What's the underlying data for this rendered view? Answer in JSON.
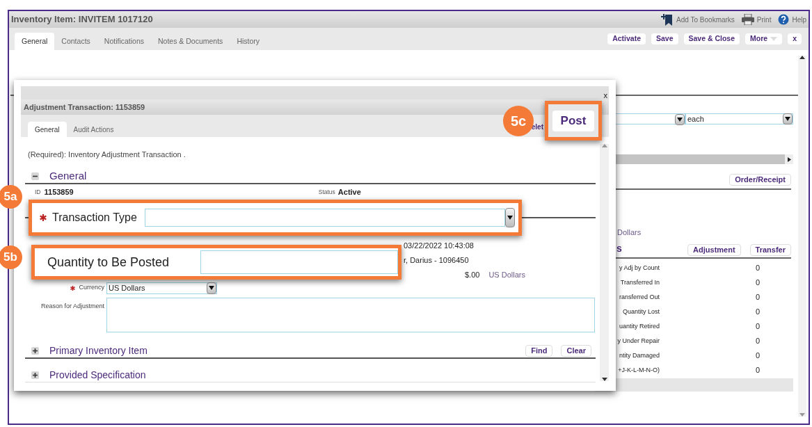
{
  "window": {
    "title": "Inventory Item: INVITEM 1017120",
    "header_links": [
      {
        "label": "Add To Bookmarks",
        "kind": "bookmark"
      },
      {
        "label": "Print",
        "kind": "print"
      },
      {
        "label": "Help",
        "kind": "help"
      }
    ]
  },
  "tabs": [
    {
      "label": "General",
      "selected": true
    },
    {
      "label": "Contacts",
      "selected": false
    },
    {
      "label": "Notifications",
      "selected": false
    },
    {
      "label": "Notes & Documents",
      "selected": false
    },
    {
      "label": "History",
      "selected": false
    }
  ],
  "actions": [
    {
      "label": "Activate",
      "kind": "plain"
    },
    {
      "label": "Save",
      "kind": "plain"
    },
    {
      "label": "Save & Close",
      "kind": "plain"
    },
    {
      "label": "More",
      "kind": "menu"
    },
    {
      "label": "x",
      "kind": "plain"
    }
  ],
  "background": {
    "unit_value": "each",
    "order_button": "Order/Receipt",
    "currency_partial": "Dollars",
    "heading_partial": "s",
    "buttons": [
      "Adjustment",
      "Transfer"
    ],
    "rows": [
      {
        "label": "y Adj by Count",
        "value": "0"
      },
      {
        "label": "Transferred In",
        "value": "0"
      },
      {
        "label": "ransferred Out",
        "value": "0"
      },
      {
        "label": "Quantity Lost",
        "value": "0"
      },
      {
        "label": "uantity Retired",
        "value": "0"
      },
      {
        "label": "y Under Repair",
        "value": "0"
      },
      {
        "label": "ntity Damaged",
        "value": "0"
      },
      {
        "label": "+J-K-L-M-N-O)",
        "value": "0"
      }
    ]
  },
  "dialog": {
    "close_label": "x",
    "title": "Adjustment Transaction: 1153859",
    "tabs": [
      {
        "label": "General",
        "selected": true
      },
      {
        "label": "Audit Actions",
        "selected": false
      }
    ],
    "partial_action": "elet",
    "required_note": "(Required): Inventory Adjustment Transaction .",
    "general": {
      "title": "General",
      "expanded": true,
      "id_label": "ID",
      "id_value": "1153859",
      "status_label": "Status",
      "status_value": "Active",
      "transaction_date": "03/22/2022 10:43:08",
      "performed_by": "r, Darius - 1096450",
      "amount": "$.00",
      "amount_currency": "US Dollars",
      "currency_label": "Currency",
      "currency_required": true,
      "currency_value": "US Dollars",
      "reason_label": "Reason for Adjustment"
    },
    "sections": [
      {
        "title": "Primary Inventory Item",
        "expanded": false,
        "buttons": [
          "Find",
          "Clear"
        ]
      },
      {
        "title": "Provided Specification",
        "expanded": false
      }
    ]
  },
  "callouts": [
    {
      "badge": "5a",
      "kind": "select",
      "label": "Transaction Type",
      "required": true
    },
    {
      "badge": "5b",
      "kind": "input",
      "label": "Quantity to Be Posted",
      "required": false
    },
    {
      "badge": "5c",
      "kind": "button",
      "label": "Post",
      "required": false
    }
  ]
}
